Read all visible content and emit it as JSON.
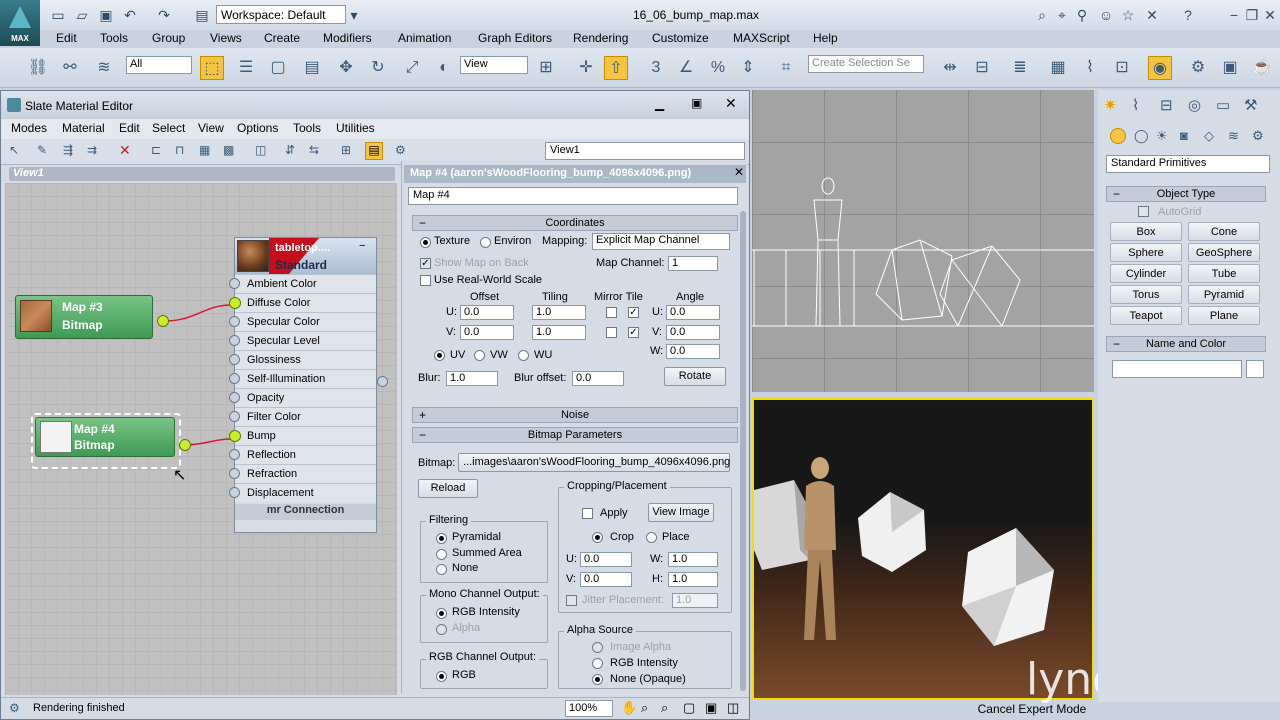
{
  "app": {
    "workspace": "Workspace: Default",
    "doc_title": "16_06_bump_map.max",
    "logo": "MAX"
  },
  "menus": [
    "Edit",
    "Tools",
    "Group",
    "Views",
    "Create",
    "Modifiers",
    "Animation",
    "Graph Editors",
    "Rendering",
    "Customize",
    "MAXScript",
    "Help"
  ],
  "toolbar": {
    "selection_filter": "All",
    "ref_coord": "View",
    "selection_set_placeholder": "Create Selection Se"
  },
  "slate": {
    "title": "Slate Material Editor",
    "menus": [
      "Modes",
      "Material",
      "Edit",
      "Select",
      "View",
      "Options",
      "Tools",
      "Utilities"
    ],
    "view_select": "View1",
    "view_tab": "View1",
    "nodes": {
      "map3": {
        "title": "Map #3",
        "sub": "Bitmap"
      },
      "map4": {
        "title": "Map #4",
        "sub": "Bitmap"
      },
      "material": {
        "title": "tabletop....",
        "sub": "Standard",
        "slots": [
          "Ambient Color",
          "Diffuse Color",
          "Specular Color",
          "Specular Level",
          "Glossiness",
          "Self-Illumination",
          "Opacity",
          "Filter Color",
          "Bump",
          "Reflection",
          "Refraction",
          "Displacement"
        ],
        "footer": "mr Connection"
      }
    },
    "status": "Rendering finished",
    "zoom": "100%"
  },
  "panel": {
    "header": "Map #4 (aaron'sWoodFlooring_bump_4096x4096.png)",
    "map_name": "Map #4",
    "coordinates": {
      "title": "Coordinates",
      "texture": "Texture",
      "environ": "Environ",
      "mapping_label": "Mapping:",
      "mapping": "Explicit Map Channel",
      "show_map_on_back": "Show Map on Back",
      "map_channel_label": "Map Channel:",
      "map_channel": "1",
      "use_real_world": "Use Real-World Scale",
      "offset": "Offset",
      "tiling": "Tiling",
      "mirror_tile": "Mirror Tile",
      "angle": "Angle",
      "u_label": "U:",
      "v_label": "V:",
      "w_label": "W:",
      "u_offset": "0.0",
      "v_offset": "0.0",
      "u_tiling": "1.0",
      "v_tiling": "1.0",
      "u_angle": "0.0",
      "v_angle": "0.0",
      "w_angle": "0.0",
      "uv": "UV",
      "vw": "VW",
      "wu": "WU",
      "blur_label": "Blur:",
      "blur": "1.0",
      "blur_offset_label": "Blur offset:",
      "blur_offset": "0.0",
      "rotate": "Rotate"
    },
    "noise": {
      "title": "Noise"
    },
    "bitmap_params": {
      "title": "Bitmap Parameters",
      "bitmap_label": "Bitmap:",
      "bitmap_path": "...images\\aaron'sWoodFlooring_bump_4096x4096.png",
      "reload": "Reload",
      "cropping": "Cropping/Placement",
      "apply": "Apply",
      "view_image": "View Image",
      "crop": "Crop",
      "place": "Place",
      "u_label": "U:",
      "v_label": "V:",
      "w_label": "W:",
      "h_label": "H:",
      "u": "0.0",
      "v": "0.0",
      "w": "1.0",
      "h": "1.0",
      "jitter": "Jitter Placement:",
      "jitter_val": "1.0",
      "filtering": "Filtering",
      "pyramidal": "Pyramidal",
      "summed": "Summed Area",
      "none": "None",
      "mono": "Mono Channel Output:",
      "rgb_intensity": "RGB Intensity",
      "alpha": "Alpha",
      "rgb_channel": "RGB Channel Output:",
      "rgb": "RGB",
      "alpha_source": "Alpha Source",
      "image_alpha": "Image Alpha",
      "rgb_intensity2": "RGB Intensity",
      "none_opaque": "None (Opaque)"
    }
  },
  "command_panel": {
    "primitive_type": "Standard Primitives",
    "object_type": "Object Type",
    "autogrid": "AutoGrid",
    "buttons": [
      "Box",
      "Cone",
      "Sphere",
      "GeoSphere",
      "Cylinder",
      "Tube",
      "Torus",
      "Pyramid",
      "Teapot",
      "Plane"
    ],
    "name_and_color": "Name and Color"
  },
  "footer": {
    "cancel_expert": "Cancel Expert Mode",
    "watermark": "lynda.com"
  },
  "colors": {
    "node_green": "#4fa864",
    "socket_on": "#c9ef2c",
    "link": "#d8182a",
    "viewport_highlight": "#f0e000"
  }
}
